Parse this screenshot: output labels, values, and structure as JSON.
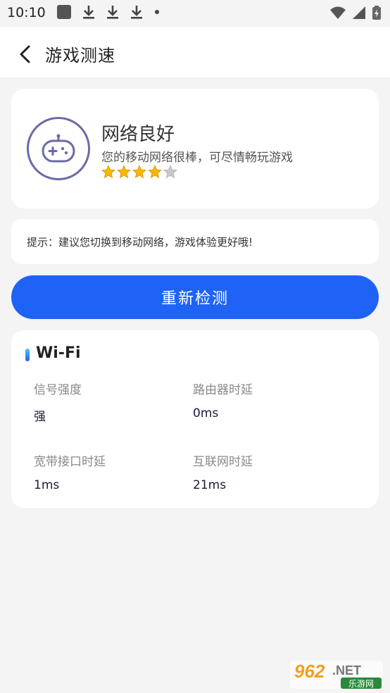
{
  "status_bar": {
    "time": "10:10"
  },
  "header": {
    "title": "游戏测速"
  },
  "network_status": {
    "title": "网络良好",
    "description": "您的移动网络很棒，可尽情畅玩游戏",
    "rating": 4,
    "rating_max": 5,
    "star_color": "#f5b800",
    "star_empty_color": "#c8c8c8",
    "icon": "gamepad-icon",
    "accent": "#6b6aa8"
  },
  "tip": {
    "text": "提示：建议您切换到移动网络，游戏体验更好哦!"
  },
  "retest_button": {
    "label": "重新检测",
    "color": "#1e63f5"
  },
  "wifi": {
    "title": "Wi-Fi",
    "metrics": [
      {
        "label": "信号强度",
        "value": "强"
      },
      {
        "label": "路由器时延",
        "value": "0ms"
      },
      {
        "label": "宽带接口时延",
        "value": "1ms"
      },
      {
        "label": "互联网时延",
        "value": "21ms"
      }
    ]
  },
  "watermark": {
    "text_main": "962",
    "text_net": ".NET",
    "text_sub": "乐游网"
  }
}
